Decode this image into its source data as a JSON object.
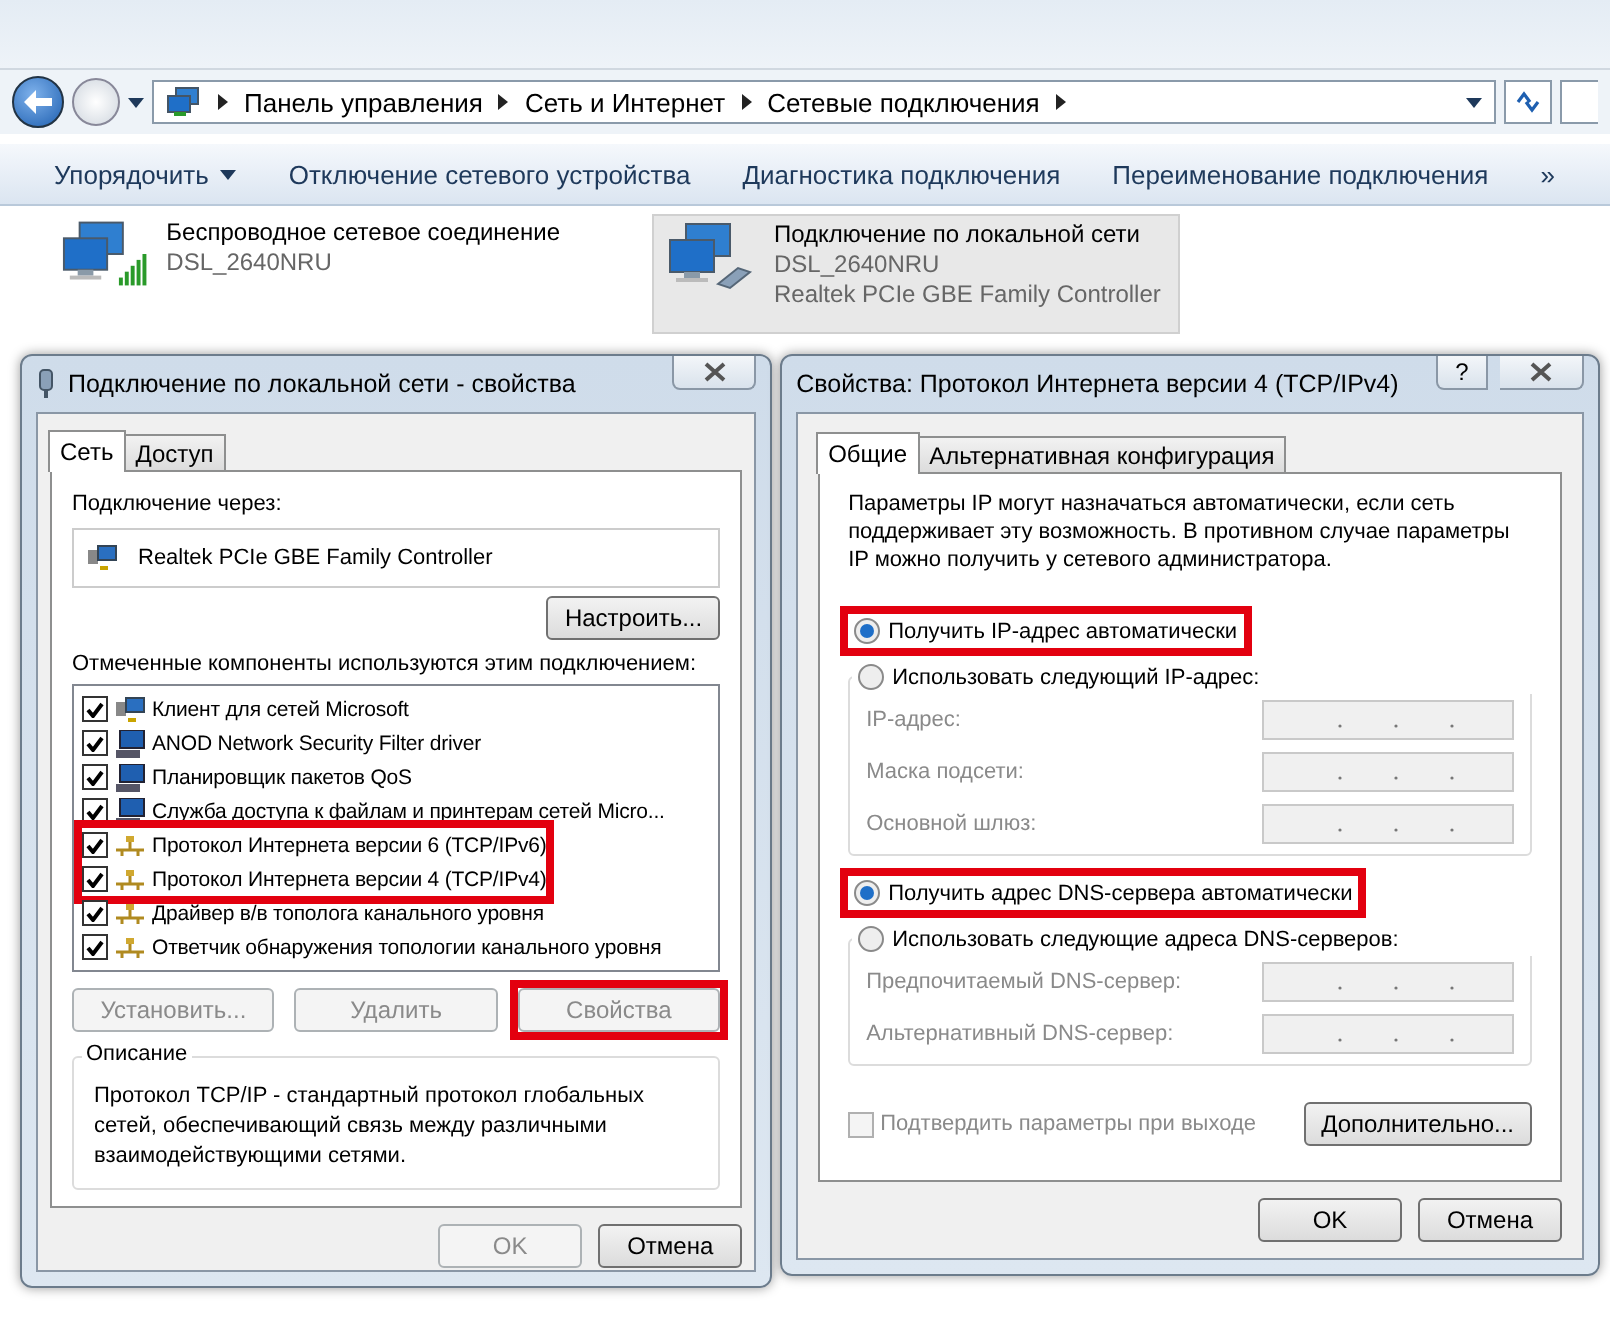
{
  "explorer": {
    "breadcrumb": [
      "Панель управления",
      "Сеть и Интернет",
      "Сетевые подключения"
    ],
    "toolbar": [
      {
        "label": "Упорядочить",
        "dropdown": true
      },
      {
        "label": "Отключение сетевого устройства",
        "dropdown": false
      },
      {
        "label": "Диагностика подключения",
        "dropdown": false
      },
      {
        "label": "Переименование подключения",
        "dropdown": false
      }
    ],
    "more": "»",
    "connections": [
      {
        "name": "Беспроводное сетевое соединение",
        "network": "DSL_2640NRU",
        "kind": "wireless",
        "selected": false
      },
      {
        "name": "Подключение по локальной сети",
        "network": "DSL_2640NRU",
        "adapter": "Realtek PCIe GBE Family Controller",
        "kind": "wired",
        "selected": true
      }
    ]
  },
  "properties_dialog": {
    "title": "Подключение по локальной сети - свойства",
    "tabs": [
      {
        "label": "Сеть",
        "selected": true
      },
      {
        "label": "Доступ",
        "selected": false
      }
    ],
    "connect_using_label": "Подключение через:",
    "adapter": "Realtek PCIe GBE Family Controller",
    "configure_button": "Настроить...",
    "components_label": "Отмеченные компоненты используются этим подключением:",
    "components": [
      {
        "label": "Клиент для сетей Microsoft",
        "kind": "client",
        "checked": true,
        "highlighted": false
      },
      {
        "label": "ANOD Network Security Filter driver",
        "kind": "service",
        "checked": true,
        "highlighted": false
      },
      {
        "label": "Планировщик пакетов QoS",
        "kind": "service",
        "checked": true,
        "highlighted": false
      },
      {
        "label": "Служба доступа к файлам и принтерам сетей Micro...",
        "kind": "service",
        "checked": true,
        "highlighted": false
      },
      {
        "label": "Протокол Интернета версии 6 (TCP/IPv6)",
        "kind": "protocol",
        "checked": true,
        "highlighted": true
      },
      {
        "label": "Протокол Интернета версии 4 (TCP/IPv4)",
        "kind": "protocol",
        "checked": true,
        "highlighted": true
      },
      {
        "label": "Драйвер в/в тополога канального уровня",
        "kind": "protocol",
        "checked": true,
        "highlighted": false
      },
      {
        "label": "Ответчик обнаружения топологии канального уровня",
        "kind": "protocol",
        "checked": true,
        "highlighted": false
      }
    ],
    "buttons": [
      {
        "label": "Установить...",
        "disabled": true,
        "highlighted": false
      },
      {
        "label": "Удалить",
        "disabled": true,
        "highlighted": false
      },
      {
        "label": "Свойства",
        "disabled": true,
        "highlighted": true
      }
    ],
    "description_title": "Описание",
    "description": "Протокол TCP/IP - стандартный протокол глобальных сетей, обеспечивающий связь между различными взаимодействующими сетями.",
    "footer_buttons": [
      {
        "label": "OK",
        "disabled": true
      },
      {
        "label": "Отмена",
        "disabled": false
      }
    ]
  },
  "ipv4_dialog": {
    "title": "Свойства: Протокол Интернета версии 4 (TCP/IPv4)",
    "help_button": "?",
    "tabs": [
      {
        "label": "Общие",
        "selected": true
      },
      {
        "label": "Альтернативная конфигурация",
        "selected": false
      }
    ],
    "intro": "Параметры IP могут назначаться автоматически, если сеть поддерживает эту возможность. В противном случае параметры IP можно получить у сетевого администратора.",
    "ip_options": [
      {
        "label": "Получить IP-адрес автоматически",
        "selected": true,
        "highlighted": true
      },
      {
        "label": "Использовать следующий IP-адрес:",
        "selected": false,
        "highlighted": false
      }
    ],
    "ip_fields": [
      {
        "label": "IP-адрес:",
        "disabled": true
      },
      {
        "label": "Маска подсети:",
        "disabled": true
      },
      {
        "label": "Основной шлюз:",
        "disabled": true
      }
    ],
    "dns_options": [
      {
        "label": "Получить адрес DNS-сервера автоматически",
        "selected": true,
        "highlighted": true
      },
      {
        "label": "Использовать следующие адреса DNS-серверов:",
        "selected": false,
        "highlighted": false
      }
    ],
    "dns_fields": [
      {
        "label": "Предпочитаемый DNS-сервер:",
        "disabled": true
      },
      {
        "label": "Альтернативный DNS-сервер:",
        "disabled": true
      }
    ],
    "validate": {
      "label": "Подтвердить параметры при выходе",
      "checked": false,
      "disabled": true
    },
    "advanced_button": "Дополнительно...",
    "footer_buttons": [
      {
        "label": "OK",
        "disabled": false
      },
      {
        "label": "Отмена",
        "disabled": false
      }
    ]
  }
}
